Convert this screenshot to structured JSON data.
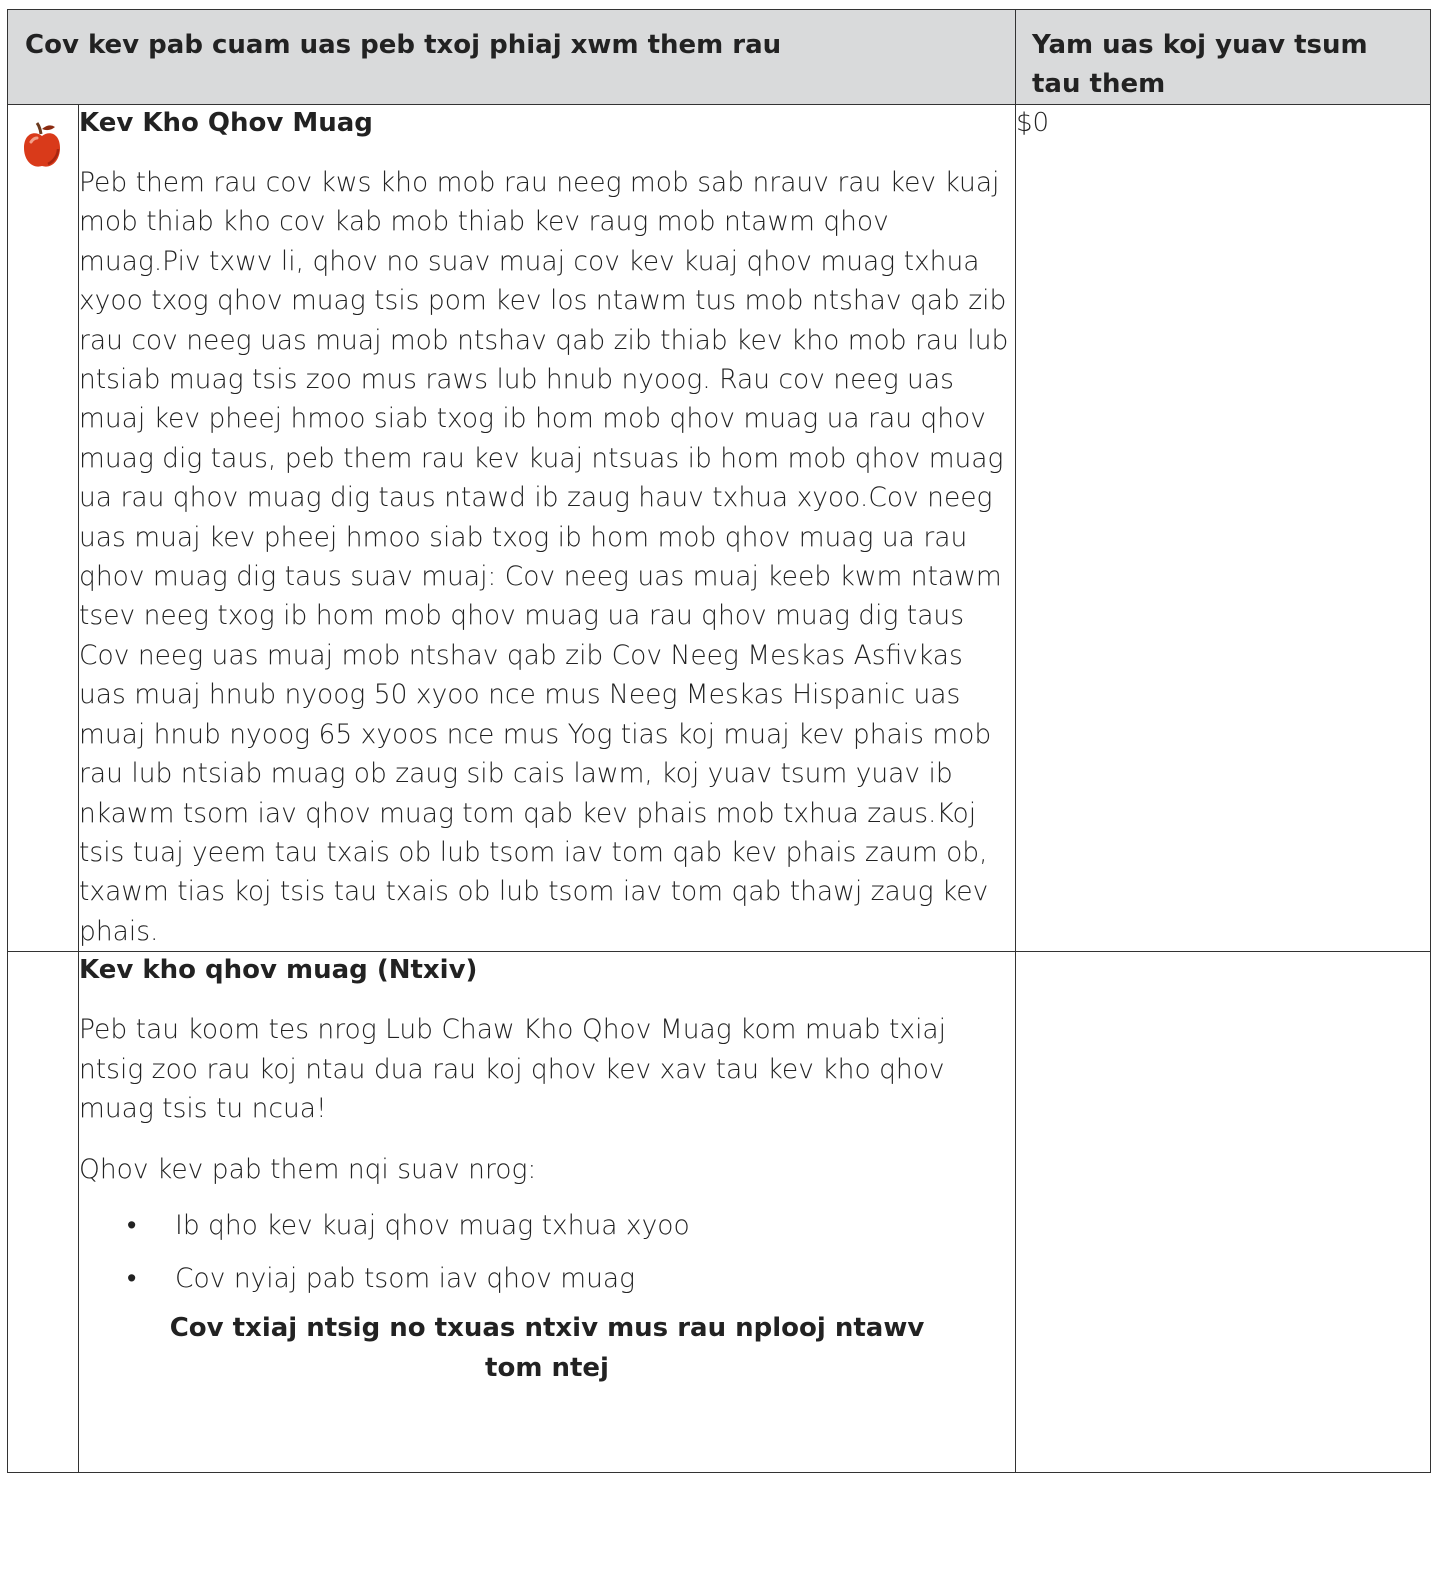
{
  "header": {
    "col_benefit": "Cov kev pab cuam uas peb txoj phiaj xwm them rau",
    "col_cost": "Yam uas koj yuav tsum tau them"
  },
  "rows": [
    {
      "icon": "apple-icon",
      "title": "Kev Kho Qhov Muag",
      "body": "Peb them rau cov kws kho mob rau neeg mob sab nrauv rau kev kuaj mob thiab kho cov kab mob thiab kev raug mob ntawm qhov muag.Piv txwv li, qhov no suav muaj cov kev kuaj qhov muag txhua xyoo txog qhov muag tsis pom kev los ntawm tus mob ntshav qab zib rau cov neeg uas muaj mob ntshav qab zib thiab kev kho mob rau lub ntsiab muag tsis zoo mus raws lub hnub nyoog. Rau cov neeg uas muaj kev pheej hmoo siab txog ib hom mob qhov muag ua rau qhov muag dig taus, peb them rau kev kuaj ntsuas ib hom mob qhov muag ua rau qhov muag dig taus ntawd ib zaug hauv txhua xyoo.Cov neeg uas muaj kev pheej hmoo siab txog ib hom mob qhov muag ua rau qhov muag dig taus suav muaj: Cov neeg uas muaj keeb kwm ntawm tsev neeg txog ib hom mob qhov muag ua rau qhov muag dig taus Cov neeg uas muaj mob ntshav qab zib Cov Neeg Meskas Asfivkas uas muaj hnub nyoog 50 xyoo nce mus Neeg Meskas Hispanic uas muaj hnub nyoog 65 xyoos nce mus Yog tias koj muaj kev phais mob rau lub ntsiab muag ob zaug sib cais lawm, koj yuav tsum yuav ib nkawm tsom iav qhov muag tom qab kev phais mob txhua zaus.Koj tsis tuaj yeem tau txais ob lub tsom iav tom qab kev phais zaum ob, txawm tias koj tsis tau txais ob lub tsom iav tom qab thawj zaug kev phais.",
      "cost": "$0"
    },
    {
      "title": "Kev kho qhov muag (Ntxiv)",
      "intro": "Peb tau koom tes nrog Lub Chaw Kho Qhov Muag kom muab txiaj ntsig zoo rau koj ntau dua rau koj qhov kev xav tau kev kho qhov muag tsis tu ncua!",
      "list_intro": "Qhov kev pab them nqi suav nrog:",
      "bullets": [
        "Ib qho kev kuaj qhov muag txhua xyoo",
        "Cov nyiaj pab tsom iav qhov muag"
      ],
      "footnote": "Cov txiaj ntsig no txuas ntxiv mus rau nplooj ntawv tom ntej",
      "cost": ""
    }
  ]
}
